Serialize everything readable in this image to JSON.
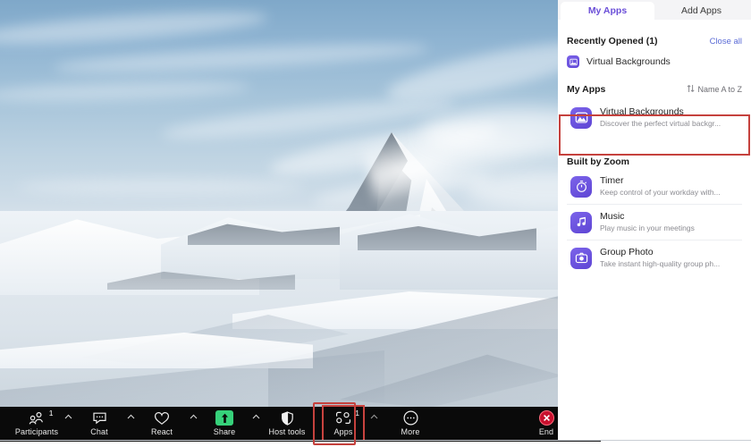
{
  "panel": {
    "tabs": [
      {
        "label": "My Apps",
        "active": true
      },
      {
        "label": "Add Apps",
        "active": false
      }
    ],
    "recently_opened": {
      "title": "Recently Opened (1)",
      "close_all": "Close all",
      "items": [
        {
          "name": "Virtual Backgrounds",
          "icon": "image-mountain-icon"
        }
      ]
    },
    "my_apps": {
      "title": "My Apps",
      "sort_label": "Name A to Z",
      "sort_icon": "sort-arrows-icon",
      "items": [
        {
          "name": "Virtual Backgrounds",
          "description": "Discover the perfect virtual backgr...",
          "icon": "image-mountain-icon",
          "highlighted": true
        }
      ]
    },
    "built_by_zoom": {
      "title": "Built by Zoom",
      "items": [
        {
          "name": "Timer",
          "description": "Keep control of your workday with...",
          "icon": "stopwatch-icon"
        },
        {
          "name": "Music",
          "description": "Play music in your meetings",
          "icon": "music-note-icon"
        },
        {
          "name": "Group Photo",
          "description": "Take instant high-quality group ph...",
          "icon": "camera-icon"
        }
      ]
    }
  },
  "toolbar": {
    "items": [
      {
        "label": "Participants",
        "icon": "participants-icon",
        "count": "1",
        "caret": true,
        "highlighted": false
      },
      {
        "label": "Chat",
        "icon": "chat-icon",
        "count": "",
        "caret": true,
        "highlighted": false
      },
      {
        "label": "React",
        "icon": "heart-icon",
        "count": "",
        "caret": true,
        "highlighted": false
      },
      {
        "label": "Share",
        "icon": "share-screen-icon",
        "count": "",
        "caret": true,
        "highlighted": false
      },
      {
        "label": "Host tools",
        "icon": "shield-icon",
        "count": "",
        "caret": false,
        "highlighted": false
      },
      {
        "label": "Apps",
        "icon": "apps-icon",
        "count": "1",
        "caret": true,
        "highlighted": true
      },
      {
        "label": "More",
        "icon": "more-ellipsis-icon",
        "count": "",
        "caret": false,
        "highlighted": false
      }
    ],
    "end": {
      "label": "End",
      "icon": "end-call-icon"
    }
  },
  "colors": {
    "accent_purple": "#6b4fd8",
    "app_icon_purple": "#5f46d6",
    "share_green": "#36d17a",
    "end_red": "#c8102e",
    "highlight_red": "#c5413d",
    "toolbar_bg": "#0a0a0a",
    "link_blue": "#5b6bd6"
  },
  "video": {
    "description": "Snowy mountain peak virtual background"
  }
}
